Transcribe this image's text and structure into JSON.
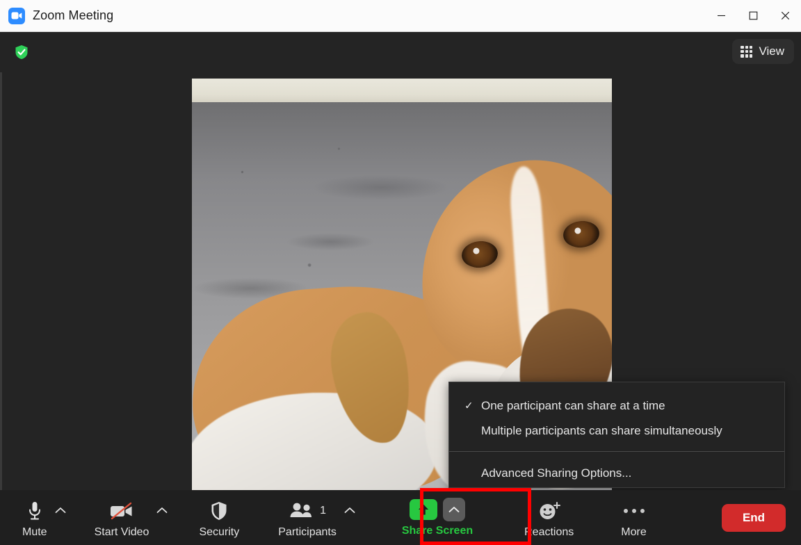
{
  "window": {
    "title": "Zoom Meeting",
    "logo_icon": "zoom-camera-icon",
    "controls": [
      {
        "name": "minimize",
        "icon": "minimize-icon"
      },
      {
        "name": "maximize",
        "icon": "maximize-icon"
      },
      {
        "name": "close",
        "icon": "close-icon"
      }
    ]
  },
  "topbar": {
    "encryption_icon": "green-shield-check-icon",
    "view_button": {
      "label": "View",
      "icon": "grid-icon"
    }
  },
  "stage": {
    "video_tile": {
      "name": "participant-video",
      "description": "dog on gravel"
    },
    "self_view": {
      "name": "self-view-thumbnail"
    }
  },
  "share_menu": {
    "items": [
      {
        "label": "One participant can share at a time",
        "checked": true,
        "check_glyph": "✓"
      },
      {
        "label": "Multiple participants can share simultaneously",
        "checked": false
      },
      {
        "label": "Advanced Sharing Options...",
        "checked": false
      }
    ]
  },
  "toolbar": {
    "mute": {
      "label": "Mute",
      "icon": "microphone-icon",
      "caret": "chevron-up-icon"
    },
    "video": {
      "label": "Start Video",
      "icon": "camera-off-icon",
      "caret": "chevron-up-icon"
    },
    "security": {
      "label": "Security",
      "icon": "shield-icon"
    },
    "participants": {
      "label": "Participants",
      "icon": "people-icon",
      "count": "1",
      "caret": "chevron-up-icon"
    },
    "share_screen": {
      "label": "Share Screen",
      "icon": "share-up-arrow-icon",
      "caret": "chevron-up-icon"
    },
    "reactions": {
      "label": "Reactions",
      "icon": "smiley-plus-icon"
    },
    "more": {
      "label": "More",
      "icon": "ellipsis-icon"
    },
    "end": {
      "label": "End"
    }
  },
  "annotation": {
    "highlight_color": "#ff0000",
    "target": "share-screen-button"
  },
  "colors": {
    "accent_green": "#27c840",
    "end_red": "#d22b2b",
    "toolbar_bg": "#1f1f1f",
    "stage_bg": "#242424",
    "menu_bg": "#232323",
    "titlebar_bg": "#fbfbfb"
  }
}
